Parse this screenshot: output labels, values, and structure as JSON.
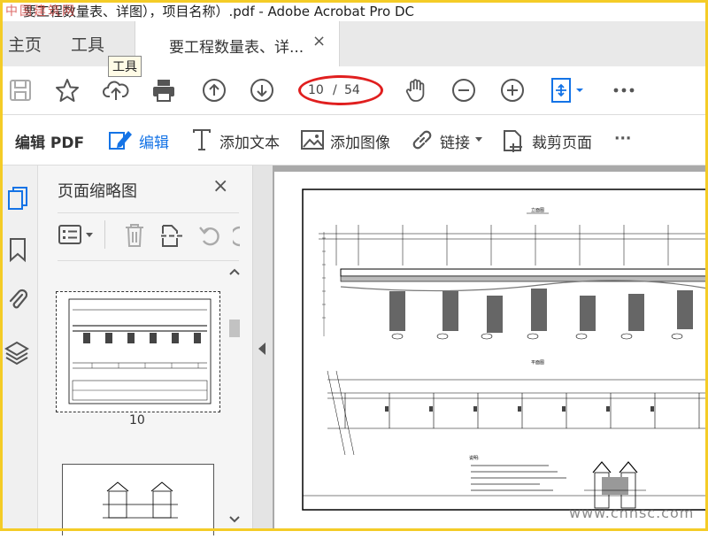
{
  "window": {
    "title": "要工程数量表、详图），项目名称）.pdf - Adobe Acrobat Pro DC",
    "overlay_watermark": "中国建筑网"
  },
  "tabs": {
    "home": "主页",
    "tools": "工具",
    "document": "要工程数量表、详...",
    "close_glyph": "×"
  },
  "tooltip": {
    "text": "工具"
  },
  "toolbar": {
    "icons": [
      "save-icon",
      "star-icon",
      "upload-cloud-icon",
      "print-icon",
      "page-up-icon",
      "page-down-icon",
      "hand-icon",
      "zoom-out-icon",
      "zoom-in-icon",
      "fit-page-icon",
      "more-icon"
    ],
    "current_page": "10",
    "separator": "/",
    "total_pages": "54",
    "highlight_color": "#e01f1f"
  },
  "edit_toolbar": {
    "mode_label": "编辑 PDF",
    "edit": "编辑",
    "add_text": "添加文本",
    "add_image": "添加图像",
    "link": "链接",
    "crop": "裁剪页面",
    "more": "···",
    "accent_color": "#1473e6"
  },
  "left_rail": {
    "icons": [
      "page-thumbnails-icon",
      "bookmark-icon",
      "attachment-icon",
      "layers-icon"
    ]
  },
  "thumbnail_panel": {
    "title": "页面缩略图",
    "close_glyph": "×",
    "tool_icons": [
      "thumbnail-options-icon",
      "delete-icon",
      "insert-page-icon",
      "undo-icon"
    ],
    "pages": [
      {
        "label": "10",
        "selected": true
      },
      {
        "label": "",
        "selected": false
      }
    ]
  },
  "document": {
    "plan_title": "立面图",
    "section_title": "平面图",
    "note_heading": "说明:",
    "watermark": "www.cnnsc.com"
  }
}
